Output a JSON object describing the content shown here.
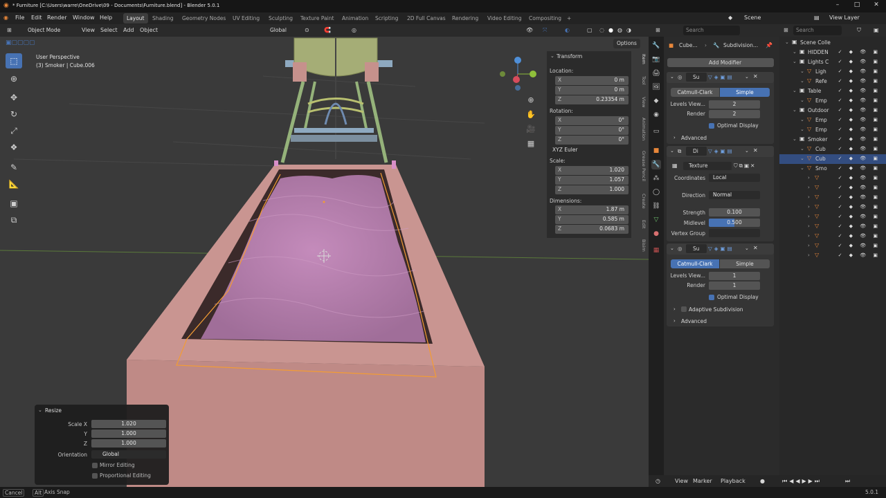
{
  "window": {
    "title": "* Furniture [C:\\Users\\warre\\OneDrive\\09 - Documents\\Furniture.blend] - Blender 5.0.1",
    "minimize": "–",
    "maximize": "□",
    "close": "✕"
  },
  "menu": [
    "File",
    "Edit",
    "Render",
    "Window",
    "Help"
  ],
  "workspaces": [
    "Layout",
    "Shading",
    "Geometry Nodes",
    "UV Editing",
    "Sculpting",
    "Texture Paint",
    "Animation",
    "Scripting",
    "2D Full Canvas",
    "Rendering",
    "Video Editing",
    "Compositing",
    "+"
  ],
  "scene": "Scene",
  "view_layer": "View Layer",
  "viewport": {
    "mode": "Object Mode",
    "menus": [
      "View",
      "Select",
      "Add",
      "Object"
    ],
    "orientation": "Global",
    "options": "Options",
    "overlay_title": "User Perspective",
    "overlay_sub": "(3) Smoker | Cube.006"
  },
  "npanel": {
    "section": "Transform",
    "location_label": "Location:",
    "location": [
      {
        "axis": "X",
        "value": "0 m"
      },
      {
        "axis": "Y",
        "value": "0 m"
      },
      {
        "axis": "Z",
        "value": "0.23354 m"
      }
    ],
    "rotation_label": "Rotation:",
    "rotation": [
      {
        "axis": "X",
        "value": "0°"
      },
      {
        "axis": "Y",
        "value": "0°"
      },
      {
        "axis": "Z",
        "value": "0°"
      }
    ],
    "rotation_mode": "XYZ Euler",
    "scale_label": "Scale:",
    "scale": [
      {
        "axis": "X",
        "value": "1.020"
      },
      {
        "axis": "Y",
        "value": "1.057"
      },
      {
        "axis": "Z",
        "value": "1.000"
      }
    ],
    "dimensions_label": "Dimensions:",
    "dimensions": [
      {
        "axis": "X",
        "value": "1.87 m"
      },
      {
        "axis": "Y",
        "value": "0.585 m"
      },
      {
        "axis": "Z",
        "value": "0.0683 m"
      }
    ],
    "tabs": [
      "Item",
      "Tool",
      "View",
      "Animation",
      "Grease Pencil",
      "Create",
      "Edit",
      "Bisim"
    ]
  },
  "resize_panel": {
    "title": "Resize",
    "rows": [
      {
        "label": "Scale X",
        "value": "1.020"
      },
      {
        "label": "Y",
        "value": "1.000"
      },
      {
        "label": "Z",
        "value": "1.000"
      }
    ],
    "orientation_label": "Orientation",
    "orientation_value": "Global",
    "mirror": "Mirror Editing",
    "proportional": "Proportional Editing"
  },
  "properties": {
    "search_placeholder": "Search",
    "breadcrumb_object": "Cube...",
    "breadcrumb_modifier": "Subdivision...",
    "add_modifier": "Add Modifier",
    "mod1": {
      "name": "Su",
      "seg_a": "Catmull-Clark",
      "seg_b": "Simple",
      "levels_label": "Levels View...",
      "levels": "2",
      "render_label": "Render",
      "render": "2",
      "optimal": "Optimal Display",
      "advanced": "Advanced"
    },
    "mod2": {
      "name": "Di",
      "texture": "Texture",
      "coords_label": "Coordinates",
      "coords": "Local",
      "direction_label": "Direction",
      "direction": "Normal",
      "strength_label": "Strength",
      "strength": "0.100",
      "midlevel_label": "Midlevel",
      "midlevel": "0.500",
      "vgroup_label": "Vertex Group"
    },
    "mod3": {
      "name": "Su",
      "seg_a": "Catmull-Clark",
      "seg_b": "Simple",
      "levels_label": "Levels View...",
      "levels": "1",
      "render_label": "Render",
      "render": "1",
      "optimal": "Optimal Display",
      "adaptive": "Adaptive Subdivision",
      "advanced": "Advanced"
    }
  },
  "outliner": {
    "search_placeholder": "Search",
    "rows": [
      {
        "label": "Scene Colle",
        "indent": 0
      },
      {
        "label": "HIDDEN",
        "indent": 1
      },
      {
        "label": "Lights C",
        "indent": 1
      },
      {
        "label": "Ligh",
        "indent": 2
      },
      {
        "label": "Refe",
        "indent": 2
      },
      {
        "label": "Table",
        "indent": 1
      },
      {
        "label": "Emp",
        "indent": 2
      },
      {
        "label": "Outdoor",
        "indent": 1
      },
      {
        "label": "Emp",
        "indent": 2
      },
      {
        "label": "Emp",
        "indent": 2
      },
      {
        "label": "Smoker",
        "indent": 1
      },
      {
        "label": "Cub",
        "indent": 2
      },
      {
        "label": "Cub",
        "indent": 2
      },
      {
        "label": "Smo",
        "indent": 2
      },
      {
        "label": "",
        "indent": 3
      },
      {
        "label": "",
        "indent": 3
      },
      {
        "label": "",
        "indent": 3
      },
      {
        "label": "",
        "indent": 3
      },
      {
        "label": "",
        "indent": 3
      },
      {
        "label": "",
        "indent": 3
      },
      {
        "label": "",
        "indent": 3
      },
      {
        "label": "",
        "indent": 3
      },
      {
        "label": "",
        "indent": 3
      }
    ],
    "selected_index": 12
  },
  "timeline": {
    "menus": [
      "View",
      "Marker",
      "Playback"
    ]
  },
  "status": {
    "cancel": "Cancel",
    "alt": "Alt",
    "axis_snap": "Axis Snap",
    "version": "5.0.1"
  },
  "colors": {
    "accent": "#4772b3",
    "selection": "#f39c34",
    "mesh": "#c6918c",
    "fluid": "#b87eae"
  }
}
